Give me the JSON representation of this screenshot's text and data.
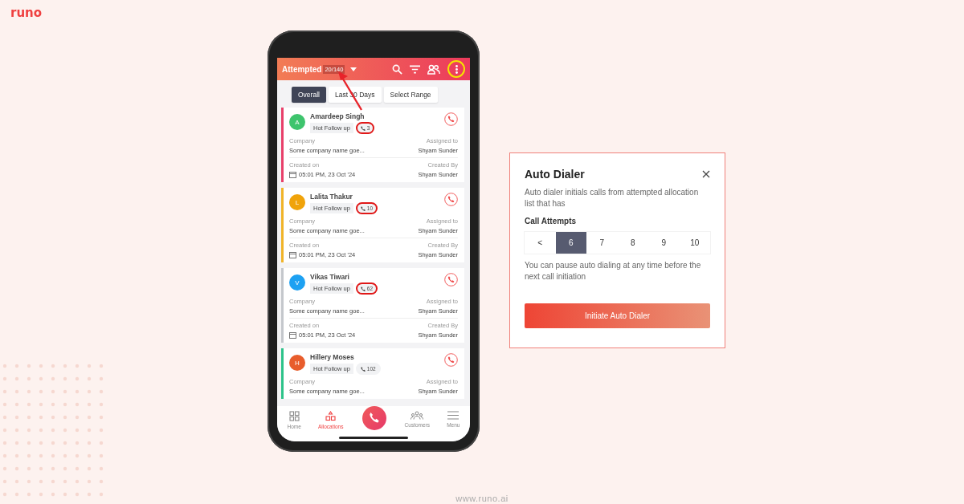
{
  "brand": {
    "logo": "runo",
    "footer_url": "www.runo.ai"
  },
  "phone": {
    "header": {
      "title": "Attempted",
      "count": "20/140",
      "menu_highlighted": true
    },
    "filters": [
      {
        "label": "Overall",
        "selected": true
      },
      {
        "label": "Last 30 Days",
        "selected": false
      },
      {
        "label": "Select Range",
        "selected": false
      }
    ],
    "leads": [
      {
        "avatar": {
          "initial": "A",
          "color": "#3ec46d"
        },
        "name": "Amardeep Singh",
        "color": "#e8406a",
        "tag": "Hot Follow up",
        "calls": "3",
        "circled": true,
        "company_label": "Company",
        "company": "Some company name goe...",
        "assigned_label": "Assigned to",
        "assigned": "Shyam Sunder",
        "created_label": "Created on",
        "created": "05:01 PM, 23 Oct '24",
        "created_by_label": "Created By",
        "created_by": "Shyam Sunder"
      },
      {
        "avatar": {
          "initial": "L",
          "color": "#f0a30a"
        },
        "name": "Lalita Thakur",
        "color": "#f0b429",
        "tag": "Hot Follow up",
        "calls": "10",
        "circled": true,
        "company_label": "Company",
        "company": "Some company name goe...",
        "assigned_label": "Assigned to",
        "assigned": "Shyam Sunder",
        "created_label": "Created on",
        "created": "05:01 PM, 23 Oct '24",
        "created_by_label": "Created By",
        "created_by": "Shyam Sunder"
      },
      {
        "avatar": {
          "initial": "V",
          "color": "#1da1f2"
        },
        "name": "Vikas Tiwari",
        "color": "#c4c7cc",
        "tag": "Hot Follow up",
        "calls": "62",
        "circled": true,
        "company_label": "Company",
        "company": "Some company name goe...",
        "assigned_label": "Assigned to",
        "assigned": "Shyam Sunder",
        "created_label": "Created on",
        "created": "05:01 PM, 23 Oct '24",
        "created_by_label": "Created By",
        "created_by": "Shyam Sunder"
      },
      {
        "avatar": {
          "initial": "H",
          "color": "#e85d2c"
        },
        "name": "Hillery Moses",
        "color": "#2dc38a",
        "tag": "Hot Follow up",
        "calls": "102",
        "circled": false,
        "company_label": "Company",
        "company": "Some company name goe...",
        "assigned_label": "Assigned to",
        "assigned": "Shyam Sunder"
      }
    ],
    "nav": [
      {
        "label": "Home",
        "selected": false
      },
      {
        "label": "Allocations",
        "selected": true
      },
      {
        "label": "Customers",
        "selected": false
      },
      {
        "label": "Menu",
        "selected": false
      }
    ]
  },
  "dialog": {
    "title": "Auto Dialer",
    "description": "Auto dialer initials calls from attempted allocation list that has",
    "label": "Call Attempts",
    "options": [
      {
        "label": "<",
        "selected": false
      },
      {
        "label": "6",
        "selected": true
      },
      {
        "label": "7",
        "selected": false
      },
      {
        "label": "8",
        "selected": false
      },
      {
        "label": "9",
        "selected": false
      },
      {
        "label": "10",
        "selected": false
      }
    ],
    "note": "You can pause auto dialing at any time before the next call initiation",
    "button": "Initiate Auto Dialer"
  }
}
